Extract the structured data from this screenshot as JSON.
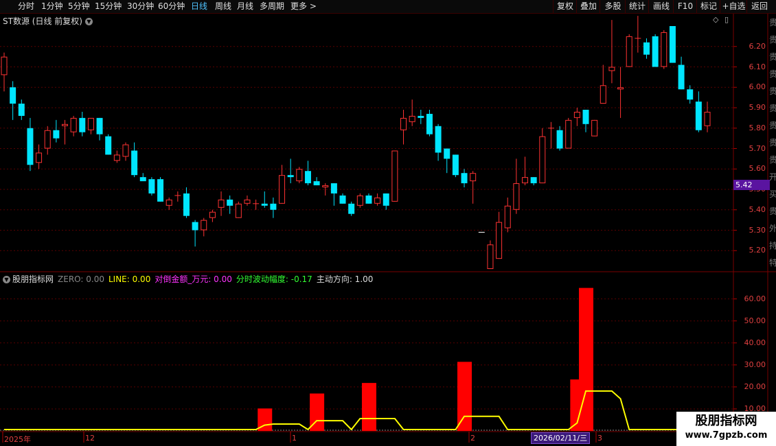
{
  "toolbar": {
    "periods": [
      "分时",
      "1分钟",
      "5分钟",
      "15分钟",
      "30分钟",
      "60分钟",
      "日线",
      "周线",
      "月线",
      "多周期",
      "更多 >"
    ],
    "active_period": "日线",
    "right_buttons": [
      "复权",
      "叠加",
      "多股",
      "统计",
      "画线",
      "F10",
      "标记",
      "+自选",
      "返回"
    ]
  },
  "chart": {
    "title": "ST数源 (日线 前复权)",
    "current_price": "5.42",
    "price_ticks": [
      "6.20",
      "6.10",
      "6.00",
      "5.90",
      "5.80",
      "5.70",
      "5.60",
      "5.50",
      "5.40",
      "5.30",
      "5.20"
    ],
    "date_labels": [
      "2025年",
      "12",
      "1",
      "2",
      "3"
    ],
    "cursor_date": "2026/02/11/三",
    "colors": {
      "up": "#ff3333",
      "down": "#00e5ff",
      "line": "#ffff00",
      "bar": "#ff0000",
      "grid": "#5a0000"
    }
  },
  "indicator": {
    "name": "股朋指标网",
    "legend": [
      {
        "label": "ZERO: 0.00",
        "color": "#888888"
      },
      {
        "label": "LINE: 0.00",
        "color": "#ffff00"
      },
      {
        "label": "对倒金额_万元: 0.00",
        "color": "#ff33ff"
      },
      {
        "label": "分时波动幅度: -0.17",
        "color": "#33ff33"
      },
      {
        "label": "主动方向: 1.00",
        "color": "#dddddd"
      }
    ],
    "ticks": [
      "60.00",
      "50.00",
      "40.00",
      "30.00",
      "20.00",
      "10.00"
    ]
  },
  "side_text": [
    "贵",
    "贵",
    "贵",
    "贵",
    "贵",
    "贵",
    "贵",
    "贵",
    "贵",
    "开",
    "买",
    "贵",
    "外",
    "持",
    "特"
  ],
  "watermark": {
    "title": "股朋指标网",
    "url": "www.7gpzb.com"
  },
  "chart_data": {
    "type": "candlestick",
    "ylim": [
      5.1,
      6.3
    ],
    "candles": [
      {
        "o": 6.06,
        "h": 6.17,
        "l": 5.98,
        "c": 6.15
      },
      {
        "o": 6.0,
        "h": 6.03,
        "l": 5.84,
        "c": 5.92
      },
      {
        "o": 5.92,
        "h": 5.94,
        "l": 5.84,
        "c": 5.86
      },
      {
        "o": 5.8,
        "h": 5.85,
        "l": 5.59,
        "c": 5.62
      },
      {
        "o": 5.63,
        "h": 5.72,
        "l": 5.6,
        "c": 5.68
      },
      {
        "o": 5.7,
        "h": 5.81,
        "l": 5.67,
        "c": 5.79
      },
      {
        "o": 5.79,
        "h": 5.84,
        "l": 5.73,
        "c": 5.75
      },
      {
        "o": 5.81,
        "h": 5.84,
        "l": 5.72,
        "c": 5.82
      },
      {
        "o": 5.78,
        "h": 5.86,
        "l": 5.76,
        "c": 5.85
      },
      {
        "o": 5.85,
        "h": 5.88,
        "l": 5.76,
        "c": 5.78
      },
      {
        "o": 5.79,
        "h": 5.82,
        "l": 5.77,
        "c": 5.85
      },
      {
        "o": 5.85,
        "h": 5.85,
        "l": 5.74,
        "c": 5.77
      },
      {
        "o": 5.76,
        "h": 5.77,
        "l": 5.67,
        "c": 5.67
      },
      {
        "o": 5.64,
        "h": 5.69,
        "l": 5.63,
        "c": 5.67
      },
      {
        "o": 5.66,
        "h": 5.73,
        "l": 5.64,
        "c": 5.72
      },
      {
        "o": 5.69,
        "h": 5.73,
        "l": 5.56,
        "c": 5.57
      },
      {
        "o": 5.56,
        "h": 5.58,
        "l": 5.55,
        "c": 5.54
      },
      {
        "o": 5.55,
        "h": 5.56,
        "l": 5.47,
        "c": 5.48
      },
      {
        "o": 5.55,
        "h": 5.56,
        "l": 5.44,
        "c": 5.44
      },
      {
        "o": 5.42,
        "h": 5.46,
        "l": 5.4,
        "c": 5.45
      },
      {
        "o": 5.47,
        "h": 5.49,
        "l": 5.44,
        "c": 5.47
      },
      {
        "o": 5.48,
        "h": 5.51,
        "l": 5.36,
        "c": 5.37
      },
      {
        "o": 5.34,
        "h": 5.35,
        "l": 5.22,
        "c": 5.3
      },
      {
        "o": 5.3,
        "h": 5.36,
        "l": 5.27,
        "c": 5.35
      },
      {
        "o": 5.36,
        "h": 5.4,
        "l": 5.34,
        "c": 5.39
      },
      {
        "o": 5.41,
        "h": 5.49,
        "l": 5.37,
        "c": 5.45
      },
      {
        "o": 5.45,
        "h": 5.47,
        "l": 5.38,
        "c": 5.42
      },
      {
        "o": 5.36,
        "h": 5.44,
        "l": 5.36,
        "c": 5.43
      },
      {
        "o": 5.43,
        "h": 5.47,
        "l": 5.42,
        "c": 5.45
      },
      {
        "o": 5.43,
        "h": 5.45,
        "l": 5.4,
        "c": 5.43
      },
      {
        "o": 5.43,
        "h": 5.49,
        "l": 5.41,
        "c": 5.42
      },
      {
        "o": 5.43,
        "h": 5.46,
        "l": 5.36,
        "c": 5.4
      },
      {
        "o": 5.43,
        "h": 5.62,
        "l": 5.43,
        "c": 5.57
      },
      {
        "o": 5.57,
        "h": 5.65,
        "l": 5.53,
        "c": 5.56
      },
      {
        "o": 5.54,
        "h": 5.61,
        "l": 5.53,
        "c": 5.6
      },
      {
        "o": 5.59,
        "h": 5.64,
        "l": 5.52,
        "c": 5.53
      },
      {
        "o": 5.54,
        "h": 5.56,
        "l": 5.52,
        "c": 5.52
      },
      {
        "o": 5.51,
        "h": 5.53,
        "l": 5.47,
        "c": 5.52
      },
      {
        "o": 5.53,
        "h": 5.53,
        "l": 5.42,
        "c": 5.48
      },
      {
        "o": 5.47,
        "h": 5.48,
        "l": 5.43,
        "c": 5.43
      },
      {
        "o": 5.43,
        "h": 5.44,
        "l": 5.37,
        "c": 5.38
      },
      {
        "o": 5.42,
        "h": 5.48,
        "l": 5.41,
        "c": 5.47
      },
      {
        "o": 5.47,
        "h": 5.48,
        "l": 5.43,
        "c": 5.43
      },
      {
        "o": 5.43,
        "h": 5.48,
        "l": 5.42,
        "c": 5.46
      },
      {
        "o": 5.48,
        "h": 5.48,
        "l": 5.4,
        "c": 5.42
      },
      {
        "o": 5.44,
        "h": 5.69,
        "l": 5.44,
        "c": 5.69
      },
      {
        "o": 5.79,
        "h": 5.89,
        "l": 5.72,
        "c": 5.85
      },
      {
        "o": 5.83,
        "h": 5.94,
        "l": 5.81,
        "c": 5.86
      },
      {
        "o": 5.86,
        "h": 5.89,
        "l": 5.82,
        "c": 5.85
      },
      {
        "o": 5.87,
        "h": 5.89,
        "l": 5.76,
        "c": 5.77
      },
      {
        "o": 5.81,
        "h": 5.82,
        "l": 5.64,
        "c": 5.68
      },
      {
        "o": 5.7,
        "h": 5.7,
        "l": 5.58,
        "c": 5.65
      },
      {
        "o": 5.67,
        "h": 5.67,
        "l": 5.56,
        "c": 5.57
      },
      {
        "o": 5.58,
        "h": 5.6,
        "l": 5.51,
        "c": 5.53
      },
      {
        "o": 5.54,
        "h": 5.59,
        "l": 5.43,
        "c": 5.58
      },
      {
        "o": 5.29,
        "h": 5.29,
        "l": 5.29,
        "c": 5.29
      },
      {
        "o": 5.11,
        "h": 5.25,
        "l": 5.11,
        "c": 5.23
      },
      {
        "o": 5.16,
        "h": 5.39,
        "l": 5.16,
        "c": 5.34
      },
      {
        "o": 5.31,
        "h": 5.46,
        "l": 5.29,
        "c": 5.42
      },
      {
        "o": 5.4,
        "h": 5.65,
        "l": 5.38,
        "c": 5.53
      },
      {
        "o": 5.53,
        "h": 5.66,
        "l": 5.52,
        "c": 5.56
      },
      {
        "o": 5.56,
        "h": 5.56,
        "l": 5.52,
        "c": 5.53
      },
      {
        "o": 5.53,
        "h": 5.8,
        "l": 5.53,
        "c": 5.76
      },
      {
        "o": 5.8,
        "h": 5.83,
        "l": 5.7,
        "c": 5.8
      },
      {
        "o": 5.79,
        "h": 5.81,
        "l": 5.69,
        "c": 5.7
      },
      {
        "o": 5.7,
        "h": 5.85,
        "l": 5.7,
        "c": 5.84
      },
      {
        "o": 5.85,
        "h": 5.9,
        "l": 5.81,
        "c": 5.88
      },
      {
        "o": 5.89,
        "h": 5.89,
        "l": 5.78,
        "c": 5.82
      },
      {
        "o": 5.76,
        "h": 5.84,
        "l": 5.76,
        "c": 5.84
      },
      {
        "o": 5.92,
        "h": 6.11,
        "l": 5.92,
        "c": 6.01
      },
      {
        "o": 6.08,
        "h": 6.33,
        "l": 6.02,
        "c": 6.1
      },
      {
        "o": 5.99,
        "h": 6.1,
        "l": 5.85,
        "c": 6.0
      },
      {
        "o": 6.1,
        "h": 6.26,
        "l": 6.1,
        "c": 6.25
      },
      {
        "o": 6.24,
        "h": 6.35,
        "l": 6.17,
        "c": 6.24
      },
      {
        "o": 6.22,
        "h": 6.24,
        "l": 6.14,
        "c": 6.16
      },
      {
        "o": 6.25,
        "h": 6.26,
        "l": 6.1,
        "c": 6.1
      },
      {
        "o": 6.1,
        "h": 6.28,
        "l": 6.09,
        "c": 6.27
      },
      {
        "o": 6.3,
        "h": 6.3,
        "l": 6.12,
        "c": 6.12
      },
      {
        "o": 6.11,
        "h": 6.15,
        "l": 5.99,
        "c": 5.99
      },
      {
        "o": 5.99,
        "h": 6.01,
        "l": 5.92,
        "c": 5.94
      },
      {
        "o": 5.93,
        "h": 5.98,
        "l": 5.78,
        "c": 5.79
      },
      {
        "o": 5.81,
        "h": 5.93,
        "l": 5.78,
        "c": 5.88
      }
    ],
    "indicator_bars": [
      {
        "index": 30,
        "value": 10.2
      },
      {
        "index": 36,
        "value": 17.0
      },
      {
        "index": 42,
        "value": 21.8
      },
      {
        "index": 53,
        "value": 31.4
      },
      {
        "index": 66,
        "value": 23.4
      },
      {
        "index": 67,
        "value": 65.0
      }
    ],
    "indicator_line": [
      0,
      0,
      0,
      0,
      0,
      0,
      0,
      0,
      0,
      0,
      0,
      0,
      0,
      0,
      0,
      0,
      0,
      0,
      0,
      0,
      0,
      0,
      0,
      0,
      0,
      0,
      0,
      0,
      0,
      0,
      2,
      2.5,
      2.5,
      2.5,
      2.5,
      0,
      4,
      4,
      4,
      4,
      0,
      5,
      5,
      5,
      5,
      5,
      0,
      0,
      0,
      0,
      0,
      0,
      0,
      6,
      6,
      6,
      6,
      6,
      0,
      0,
      0,
      0,
      0,
      0,
      0,
      0,
      3,
      17.5,
      17.5,
      17.5,
      17.5,
      14,
      0,
      0,
      0,
      0,
      0,
      0,
      0,
      0,
      0,
      0
    ],
    "indicator_ylim": [
      0,
      68
    ]
  }
}
